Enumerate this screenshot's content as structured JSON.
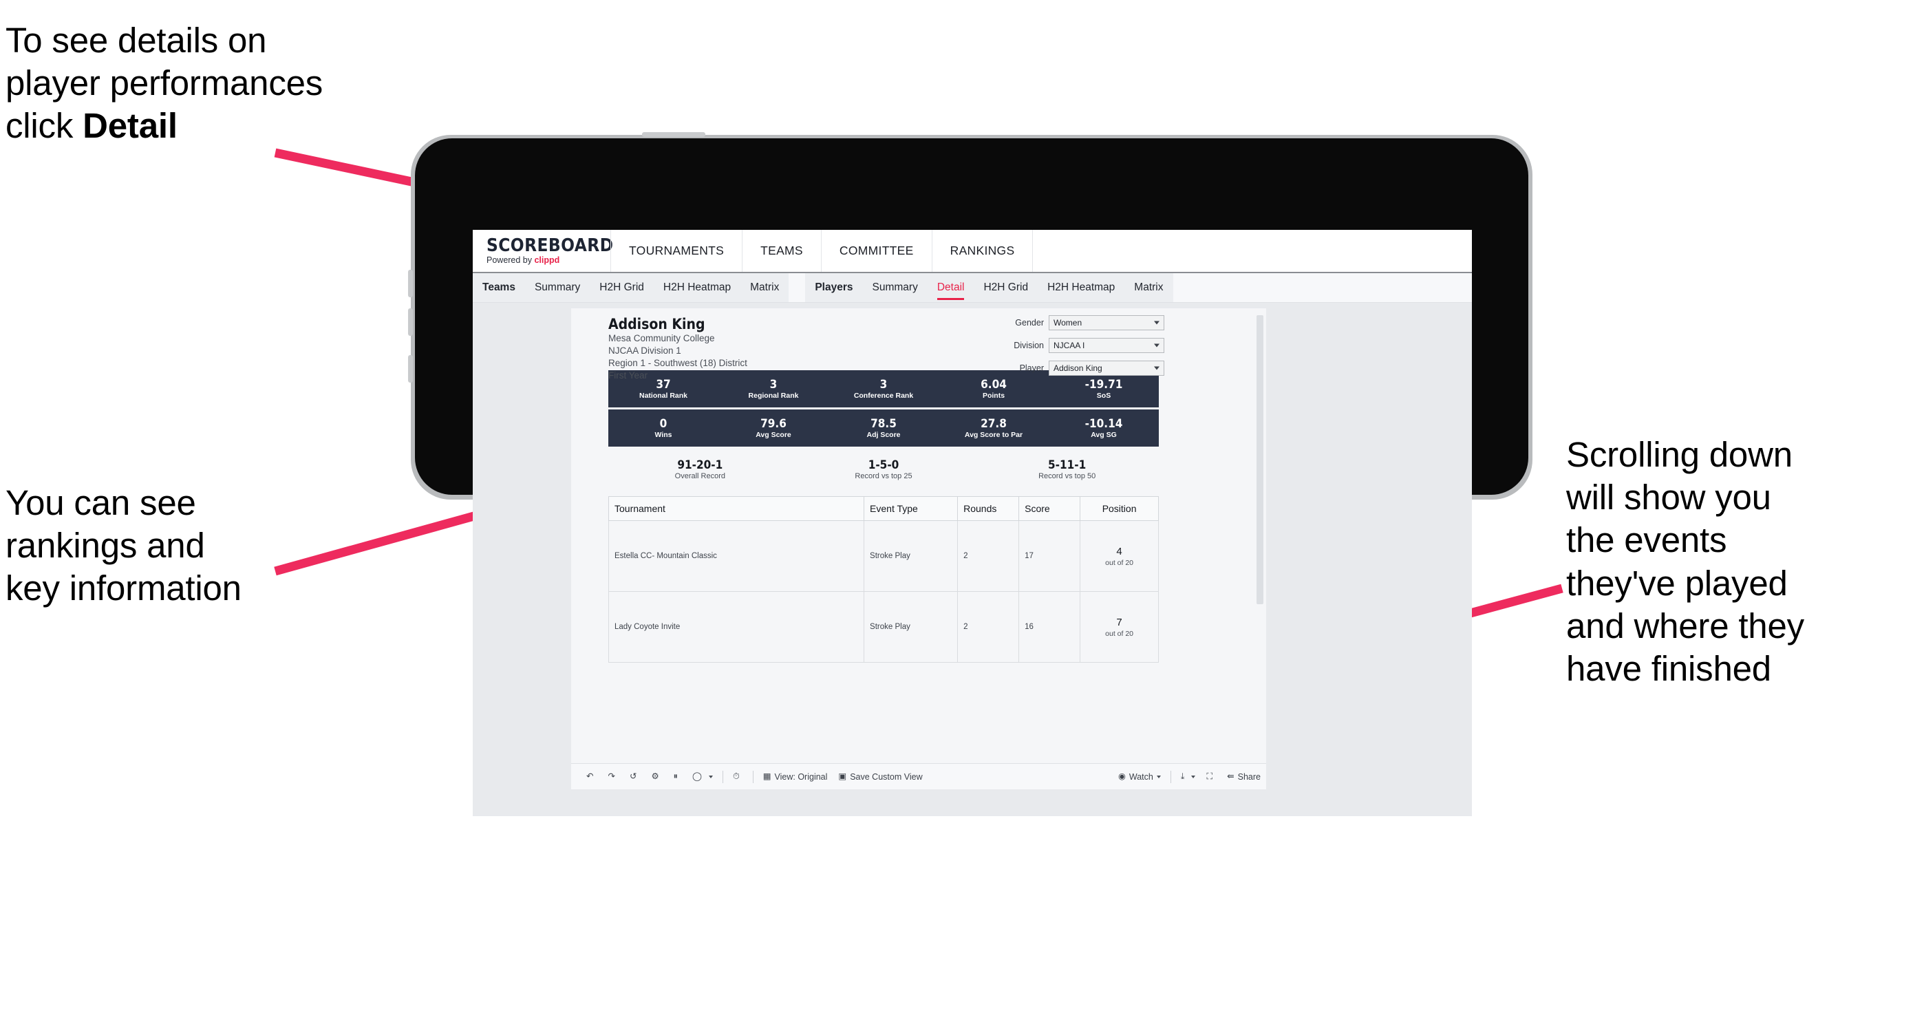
{
  "annotations": {
    "top_left": "To see details on\nplayer performances\nclick ",
    "top_left_bold": "Detail",
    "mid_left": "You can see\nrankings and\nkey information",
    "right": "Scrolling down\nwill show you\nthe events\nthey've played\nand where they\nhave finished",
    "arrow_color": "#EE2B5E"
  },
  "app": {
    "brand": {
      "title": "SCOREBOARD",
      "powered_prefix": "Powered by ",
      "powered_name": "clippd"
    },
    "top_nav": [
      {
        "label": "TOURNAMENTS"
      },
      {
        "label": "TEAMS"
      },
      {
        "label": "COMMITTEE"
      },
      {
        "label": "RANKINGS"
      }
    ],
    "sub_nav": {
      "teams_group": [
        {
          "label": "Teams",
          "active": false
        },
        {
          "label": "Summary",
          "active": false
        },
        {
          "label": "H2H Grid",
          "active": false
        },
        {
          "label": "H2H Heatmap",
          "active": false
        },
        {
          "label": "Matrix",
          "active": false
        }
      ],
      "players_group": [
        {
          "label": "Players",
          "active": false
        },
        {
          "label": "Summary",
          "active": false
        },
        {
          "label": "Detail",
          "active": true
        },
        {
          "label": "H2H Grid",
          "active": false
        },
        {
          "label": "H2H Heatmap",
          "active": false
        },
        {
          "label": "Matrix",
          "active": false
        }
      ]
    }
  },
  "player": {
    "name": "Addison King",
    "school": "Mesa Community College",
    "division": "NJCAA Division 1",
    "region": "Region 1 - Southwest (18) District",
    "year": "First Year"
  },
  "selectors": [
    {
      "label": "Gender",
      "value": "Women"
    },
    {
      "label": "Division",
      "value": "NJCAA I"
    },
    {
      "label": "Player",
      "value": "Addison King"
    }
  ],
  "stats_band_1": [
    {
      "value": "37",
      "label": "National Rank"
    },
    {
      "value": "3",
      "label": "Regional Rank"
    },
    {
      "value": "3",
      "label": "Conference Rank"
    },
    {
      "value": "6.04",
      "label": "Points"
    },
    {
      "value": "-19.71",
      "label": "SoS"
    }
  ],
  "stats_band_2": [
    {
      "value": "0",
      "label": "Wins"
    },
    {
      "value": "79.6",
      "label": "Avg Score"
    },
    {
      "value": "78.5",
      "label": "Adj Score"
    },
    {
      "value": "27.8",
      "label": "Avg Score to Par"
    },
    {
      "value": "-10.14",
      "label": "Avg SG"
    }
  ],
  "records": [
    {
      "value": "91-20-1",
      "label": "Overall Record"
    },
    {
      "value": "1-5-0",
      "label": "Record vs top 25"
    },
    {
      "value": "5-11-1",
      "label": "Record vs top 50"
    }
  ],
  "tournament_table": {
    "columns": [
      "Tournament",
      "Event Type",
      "Rounds",
      "Score",
      "Position"
    ],
    "rows": [
      {
        "tournament": "Estella CC- Mountain Classic",
        "event_type": "Stroke Play",
        "rounds": "2",
        "score": "17",
        "position": "4",
        "position_out_of": "out of 20"
      },
      {
        "tournament": "Lady Coyote Invite",
        "event_type": "Stroke Play",
        "rounds": "2",
        "score": "16",
        "position": "7",
        "position_out_of": "out of 20"
      }
    ]
  },
  "toolbar": {
    "undo": "undo-icon",
    "redo": "redo-icon",
    "revert": "revert-icon",
    "refresh": "refresh-icon",
    "pause": "pause-icon",
    "highlight": "highlight-icon",
    "clock": "clock-icon",
    "view_label": "View: Original",
    "save_view_label": "Save Custom View",
    "watch_label": "Watch",
    "download": "download-icon",
    "fullscreen": "fullscreen-icon",
    "share_label": "Share"
  }
}
